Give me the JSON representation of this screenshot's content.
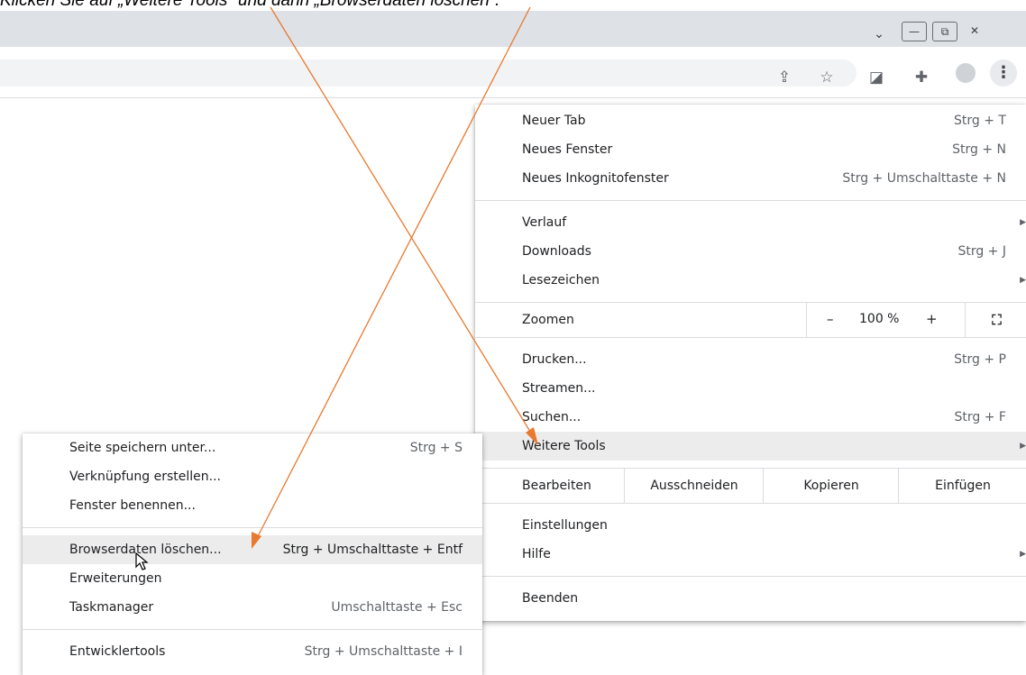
{
  "caption": "Klicken Sie auf „Weitere Tools“ und dann „Browserdaten löschen“.",
  "window": {
    "tab_search_glyph": "⌄",
    "minimize_glyph": "—",
    "restore_glyph": "⧉",
    "close_glyph": "✕"
  },
  "toolbar": {
    "share_glyph": "⇪",
    "star_glyph": "☆",
    "extension1_glyph": "◪",
    "puzzle_glyph": "✚",
    "menu_glyph": "⋮"
  },
  "main_menu": {
    "new_tab": {
      "label": "Neuer Tab",
      "shortcut": "Strg + T"
    },
    "new_window": {
      "label": "Neues Fenster",
      "shortcut": "Strg + N"
    },
    "new_incognito": {
      "label": "Neues Inkognitofenster",
      "shortcut": "Strg + Umschalttaste + N"
    },
    "history": {
      "label": "Verlauf",
      "arrow": "▶"
    },
    "downloads": {
      "label": "Downloads",
      "shortcut": "Strg + J"
    },
    "bookmarks": {
      "label": "Lesezeichen",
      "arrow": "▶"
    },
    "zoom": {
      "label": "Zoomen",
      "minus": "–",
      "value": "100 %",
      "plus": "+",
      "fullscreen": "⛶"
    },
    "print": {
      "label": "Drucken...",
      "shortcut": "Strg + P"
    },
    "cast": {
      "label": "Streamen..."
    },
    "find": {
      "label": "Suchen...",
      "shortcut": "Strg + F"
    },
    "more_tools": {
      "label": "Weitere Tools",
      "arrow": "▶"
    },
    "edit": {
      "label": "Bearbeiten",
      "cut": "Ausschneiden",
      "copy": "Kopieren",
      "paste": "Einfügen"
    },
    "settings": {
      "label": "Einstellungen"
    },
    "help": {
      "label": "Hilfe",
      "arrow": "▶"
    },
    "exit": {
      "label": "Beenden"
    }
  },
  "sub_menu": {
    "save_page": {
      "label": "Seite speichern unter...",
      "shortcut": "Strg + S"
    },
    "create_shortcut": {
      "label": "Verknüpfung erstellen..."
    },
    "name_window": {
      "label": "Fenster benennen..."
    },
    "clear_data": {
      "label": "Browserdaten löschen...",
      "shortcut": "Strg + Umschalttaste + Entf"
    },
    "extensions": {
      "label": "Erweiterungen"
    },
    "task_manager": {
      "label": "Taskmanager",
      "shortcut": "Umschalttaste + Esc"
    },
    "dev_tools": {
      "label": "Entwicklertools",
      "shortcut": "Strg + Umschalttaste + I"
    }
  },
  "colors": {
    "annotation": "#e8792e",
    "highlight": "#ececec",
    "tabstrip": "#dee1e6"
  }
}
